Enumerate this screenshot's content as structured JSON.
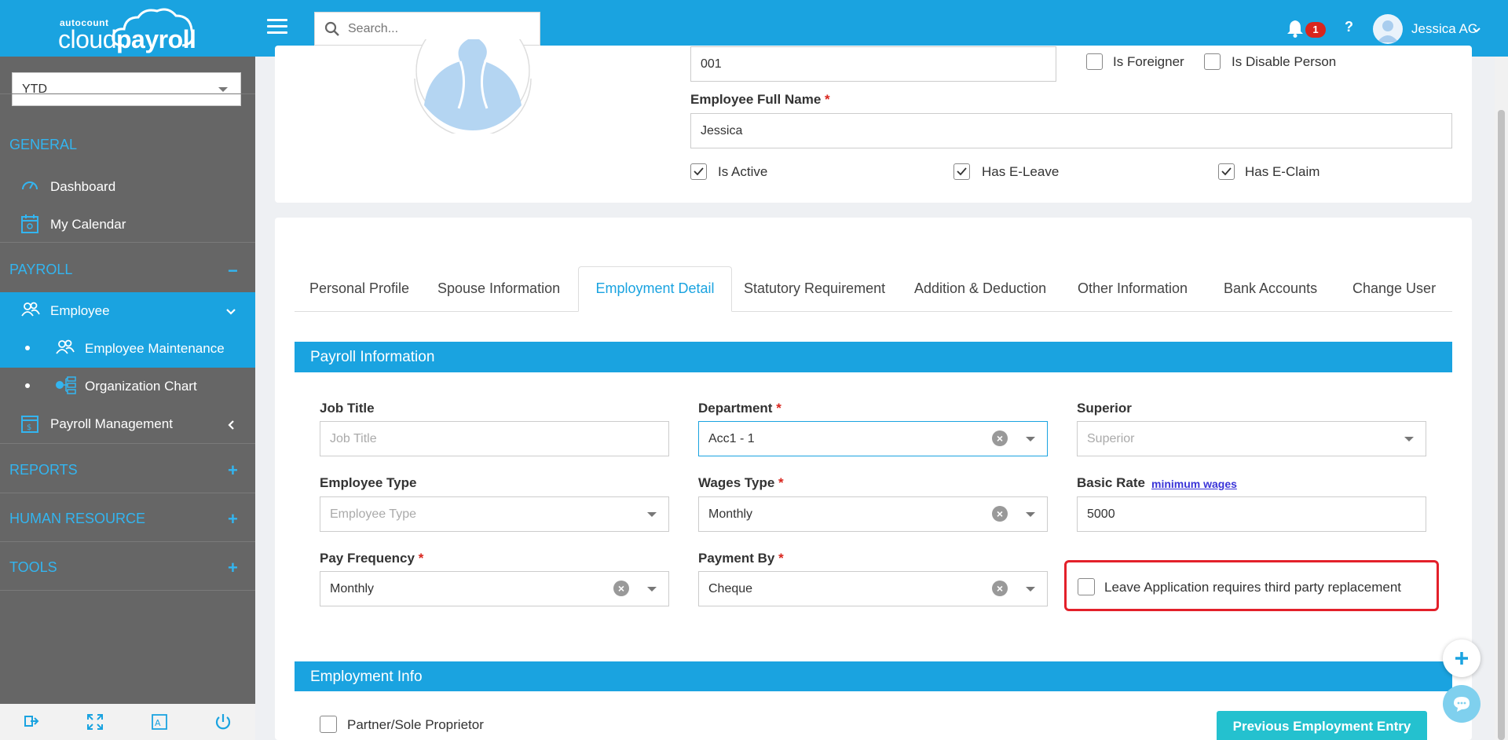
{
  "brand": {
    "small": "autocount",
    "light": "cloud",
    "bold": "payroll"
  },
  "search": {
    "placeholder": "Search..."
  },
  "header": {
    "notification_count": "1",
    "help": "?",
    "user_name": "Jessica AC"
  },
  "sidebar": {
    "period": "YTD",
    "general": "GENERAL",
    "dashboard": "Dashboard",
    "calendar": "My Calendar",
    "payroll": "PAYROLL",
    "payroll_toggle": "−",
    "employee": "Employee",
    "employee_maintenance": "Employee Maintenance",
    "org_chart": "Organization Chart",
    "payroll_management": "Payroll Management",
    "reports": "REPORTS",
    "hr": "HUMAN RESOURCE",
    "tools": "TOOLS",
    "plus": "+"
  },
  "profile": {
    "employee_no": "001",
    "is_foreigner": "Is Foreigner",
    "is_disable": "Is Disable Person",
    "full_name_label": "Employee Full Name",
    "full_name": "Jessica",
    "is_active": "Is Active",
    "has_eleave": "Has E-Leave",
    "has_eclaim": "Has E-Claim",
    "required_mark": "*"
  },
  "tabs": {
    "personal": "Personal Profile",
    "spouse": "Spouse Information",
    "employment": "Employment Detail",
    "statutory": "Statutory Requirement",
    "addition": "Addition & Deduction",
    "other": "Other Information",
    "bank": "Bank Accounts",
    "change_user": "Change User"
  },
  "payroll_info": {
    "title": "Payroll Information",
    "job_title_label": "Job Title",
    "job_title_placeholder": "Job Title",
    "department_label": "Department",
    "department": "Acc1 - 1",
    "superior_label": "Superior",
    "superior_placeholder": "Superior",
    "employee_type_label": "Employee Type",
    "employee_type_placeholder": "Employee Type",
    "wages_type_label": "Wages Type",
    "wages_type": "Monthly",
    "basic_rate_label": "Basic Rate",
    "minimum_wages": "minimum wages",
    "basic_rate": "5000",
    "pay_frequency_label": "Pay Frequency",
    "pay_frequency": "Monthly",
    "payment_by_label": "Payment By",
    "payment_by": "Cheque",
    "leave_replacement": "Leave Application requires third party replacement"
  },
  "employment_info": {
    "title": "Employment Info",
    "partner": "Partner/Sole Proprietor",
    "prev_button": "Previous Employment Entry"
  },
  "colors": {
    "primary": "#1aa3e0",
    "sidebar": "#666666",
    "accent_section": "#33b5f0",
    "highlight": "#e3202a",
    "button": "#24c1cf"
  }
}
